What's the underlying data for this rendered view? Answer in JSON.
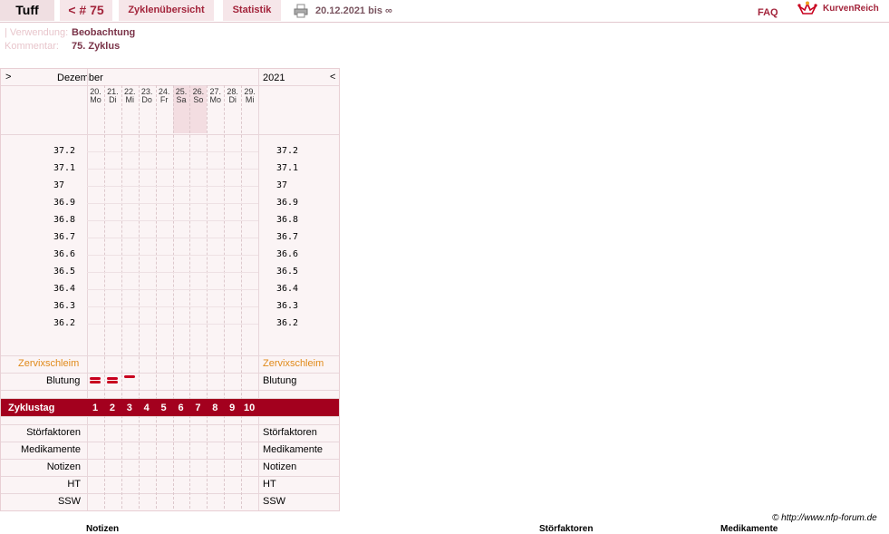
{
  "header": {
    "name": "Tuff",
    "cycle_label": "< # 75",
    "overview": "Zyklenübersicht",
    "stats": "Statistik",
    "date_range": "20.12.2021 bis ∞",
    "faq": "FAQ",
    "brand": "KurvenReich"
  },
  "meta": {
    "verwendung_key": "| Verwendung:",
    "verwendung_val": "Beobachtung",
    "kommentar_key": "Kommentar:",
    "kommentar_val": "75. Zyklus"
  },
  "chart": {
    "prev": ">",
    "month": "Dezember",
    "year": "2021",
    "next": "<",
    "days": [
      {
        "date": "20.",
        "dow": "Mo"
      },
      {
        "date": "21.",
        "dow": "Di"
      },
      {
        "date": "22.",
        "dow": "Mi"
      },
      {
        "date": "23.",
        "dow": "Do"
      },
      {
        "date": "24.",
        "dow": "Fr"
      },
      {
        "date": "25.",
        "dow": "Sa"
      },
      {
        "date": "26.",
        "dow": "So"
      },
      {
        "date": "27.",
        "dow": "Mo"
      },
      {
        "date": "28.",
        "dow": "Di"
      },
      {
        "date": "29.",
        "dow": "Mi"
      }
    ],
    "weekend_days": [
      5,
      6
    ],
    "temps": [
      "37.2",
      "37.1",
      "37",
      "36.9",
      "36.8",
      "36.7",
      "36.6",
      "36.5",
      "36.4",
      "36.3",
      "36.2"
    ],
    "zervix": "Zervixschleim",
    "blutung": "Blutung",
    "blutung_days": [
      1,
      2,
      3
    ],
    "zyklustag": "Zyklustag",
    "cycle_days": [
      "1",
      "2",
      "3",
      "4",
      "5",
      "6",
      "7",
      "8",
      "9",
      "10"
    ],
    "bottom_rows": [
      "Störfaktoren",
      "Medikamente",
      "Notizen",
      "HT",
      "SSW"
    ]
  },
  "footer": {
    "copyright": "© http://www.nfp-forum.de",
    "notizen": "Notizen",
    "stoerfaktoren": "Störfaktoren",
    "medikamente": "Medikamente"
  },
  "colors": {
    "accent": "#a3001e",
    "tab_bg": "#f6e6e9",
    "chart_bg": "#fbf4f5",
    "orange": "#e08a1a"
  }
}
